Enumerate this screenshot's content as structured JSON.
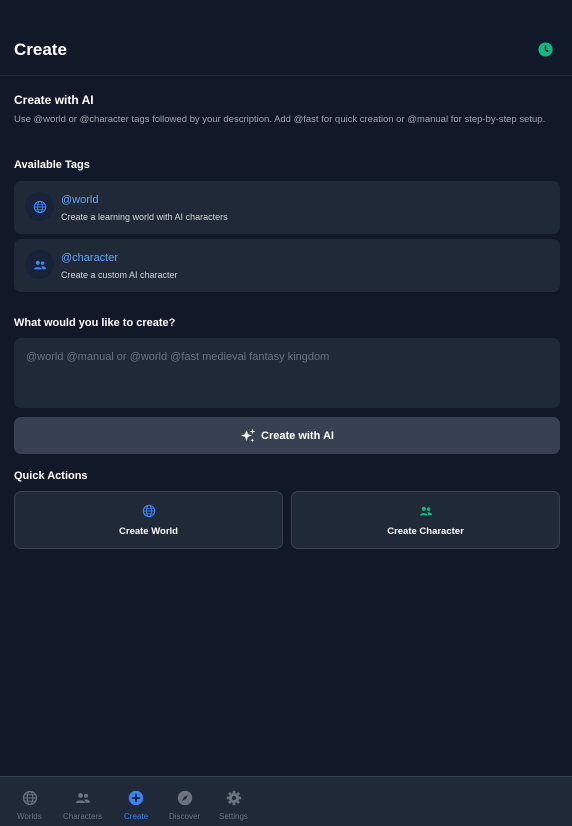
{
  "header": {
    "title": "Create"
  },
  "intro": {
    "heading": "Create with AI",
    "description": "Use @world or @character tags followed by your description. Add @fast for quick creation or @manual for step-by-step setup."
  },
  "tags": {
    "heading": "Available Tags",
    "items": [
      {
        "name": "@world",
        "description": "Create a learning world with AI characters",
        "icon": "globe-icon"
      },
      {
        "name": "@character",
        "description": "Create a custom AI character",
        "icon": "users-icon"
      }
    ]
  },
  "prompt": {
    "heading": "What would you like to create?",
    "placeholder": "@world @manual or @world @fast medieval fantasy kingdom",
    "value": ""
  },
  "ai_button": {
    "label": "Create with AI",
    "icon": "sparkles-icon"
  },
  "quick_actions": {
    "heading": "Quick Actions",
    "items": [
      {
        "label": "Create World",
        "icon": "globe-icon",
        "color": "#3b82f6"
      },
      {
        "label": "Create Character",
        "icon": "users-icon",
        "color": "#10b981"
      }
    ]
  },
  "bottom_nav": {
    "items": [
      {
        "label": "Worlds",
        "icon": "globe-icon"
      },
      {
        "label": "Characters",
        "icon": "users-icon"
      },
      {
        "label": "Create",
        "icon": "plus-circle-icon",
        "active": true
      },
      {
        "label": "Discover",
        "icon": "compass-icon"
      },
      {
        "label": "Settings",
        "icon": "gear-icon"
      }
    ]
  },
  "colors": {
    "background": "#111827",
    "card": "#1f2937",
    "accent": "#3b82f6",
    "tag_text": "#60a5fa",
    "green": "#10b981",
    "muted": "#6b7280"
  }
}
